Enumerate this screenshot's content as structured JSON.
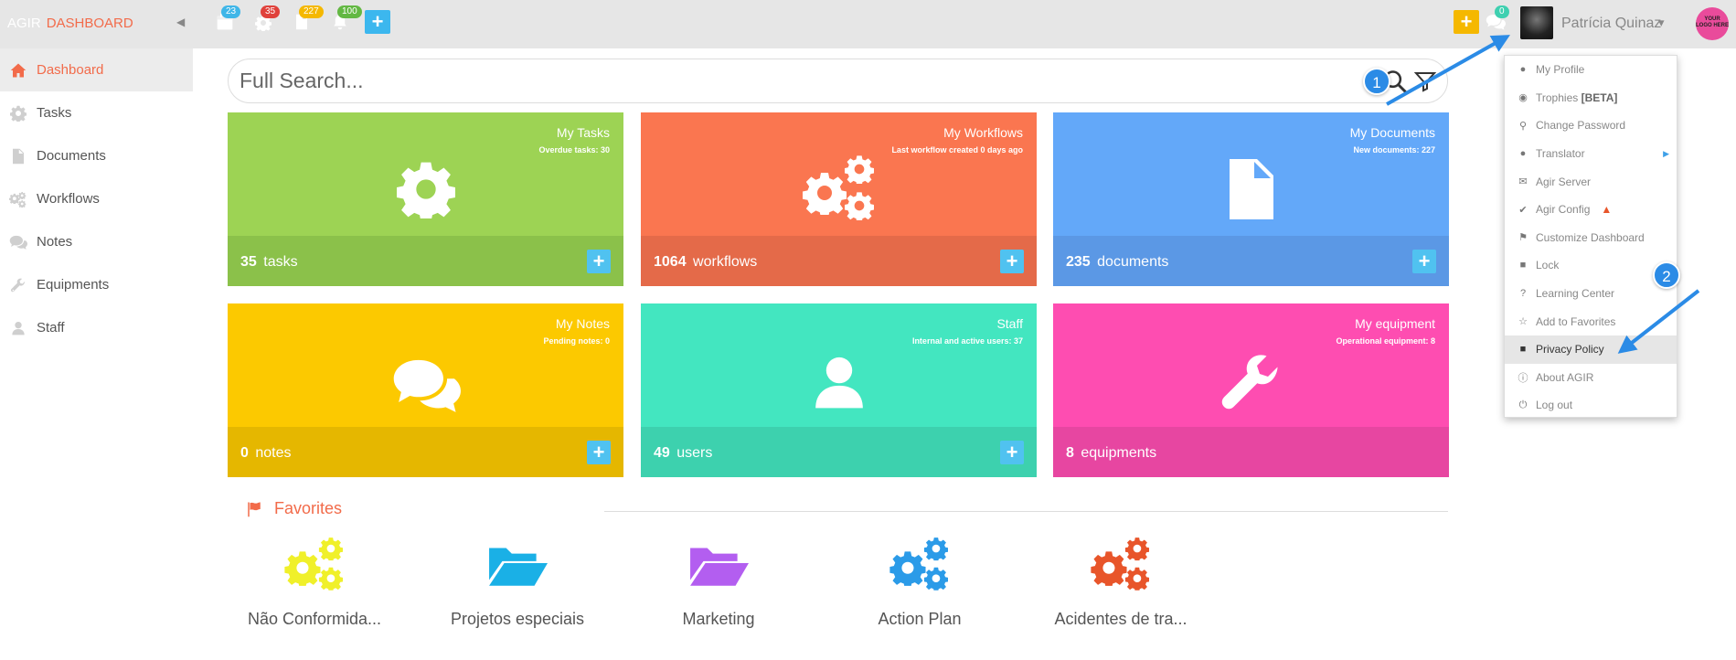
{
  "brand": {
    "app": "AGIR",
    "section": "DASHBOARD"
  },
  "topbar": {
    "badges": [
      {
        "icon": "calendar-icon",
        "count": "23",
        "color": "#3fb6e8"
      },
      {
        "icon": "gear-icon",
        "count": "35",
        "color": "#e0413b"
      },
      {
        "icon": "document-icon",
        "count": "227",
        "color": "#f5b800"
      },
      {
        "icon": "bell-icon",
        "count": "100",
        "color": "#63b843"
      }
    ],
    "add": "+",
    "quick_add": "+",
    "messages_count": "0",
    "user_name": "Patrícia Quinaz",
    "logo_text": "YOUR LOGO HERE"
  },
  "sidebar": {
    "items": [
      {
        "label": "Dashboard",
        "icon": "home-icon",
        "active": true
      },
      {
        "label": "Tasks",
        "icon": "gear-icon"
      },
      {
        "label": "Documents",
        "icon": "document-icon"
      },
      {
        "label": "Workflows",
        "icon": "workflow-icon"
      },
      {
        "label": "Notes",
        "icon": "comments-icon"
      },
      {
        "label": "Equipments",
        "icon": "wrench-icon"
      },
      {
        "label": "Staff",
        "icon": "user-icon"
      }
    ]
  },
  "search": {
    "placeholder": "Full Search..."
  },
  "tiles": [
    {
      "title": "My Tasks",
      "subtitle": "Overdue tasks: 30",
      "count": "35",
      "unit": "tasks",
      "color": "#9dd354",
      "footer": "#8bc14a",
      "icon": "gear-icon",
      "plus": "+"
    },
    {
      "title": "My Workflows",
      "subtitle": "Last workflow created 0 days ago",
      "count": "1064",
      "unit": "workflows",
      "color": "#fa7650",
      "footer": "#e46a49",
      "icon": "gears-icon",
      "plus": "+"
    },
    {
      "title": "My Documents",
      "subtitle": "New documents: 227",
      "count": "235",
      "unit": "documents",
      "color": "#63a8f9",
      "footer": "#5b98e5",
      "icon": "document-icon",
      "plus": "+"
    },
    {
      "title": "My Notes",
      "subtitle": "Pending notes: 0",
      "count": "0",
      "unit": "notes",
      "color": "#fcc900",
      "footer": "#e5b700",
      "icon": "comments-icon",
      "plus": "+"
    },
    {
      "title": "Staff",
      "subtitle": "Internal and active users: 37",
      "count": "49",
      "unit": "users",
      "color": "#43e6c0",
      "footer": "#3dd1ae",
      "icon": "user-icon",
      "plus": "+"
    },
    {
      "title": "My equipment",
      "subtitle": "Operational equipment: 8",
      "count": "8",
      "unit": "equipments",
      "color": "#fe4db1",
      "footer": "#e746a1",
      "icon": "wrench-icon"
    }
  ],
  "favorites": {
    "title": "Favorites",
    "items": [
      {
        "label": "Não Conformida...",
        "icon": "gears-icon",
        "color": "#f0f02a"
      },
      {
        "label": "Projetos especiais",
        "icon": "folder-open-icon",
        "color": "#1ab0e6"
      },
      {
        "label": "Marketing",
        "icon": "folder-open-icon",
        "color": "#b35ef0"
      },
      {
        "label": "Action Plan",
        "icon": "gears-icon",
        "color": "#2b9be8"
      },
      {
        "label": "Acidentes de tra...",
        "icon": "gears-icon",
        "color": "#e8552a"
      }
    ]
  },
  "user_menu": {
    "items": [
      {
        "label": "My Profile",
        "icon": "user-icon"
      },
      {
        "label": "Trophies",
        "badge": "[BETA]",
        "icon": "trophy-icon"
      },
      {
        "label": "Change Password",
        "icon": "key-icon"
      },
      {
        "label": "Translator",
        "icon": "globe-icon",
        "submenu": true
      },
      {
        "label": "Agir Server",
        "icon": "envelope-icon"
      },
      {
        "label": "Agir Config",
        "icon": "wrench-icon",
        "warning": true
      },
      {
        "label": "Customize Dashboard",
        "icon": "flag-icon"
      },
      {
        "label": "Lock",
        "icon": "lock-icon"
      },
      {
        "label": "Learning Center",
        "icon": "question-icon"
      },
      {
        "label": "Add to Favorites",
        "icon": "star-icon"
      },
      {
        "label": "Privacy Policy",
        "icon": "lock-icon",
        "highlight": true
      },
      {
        "label": "About AGIR",
        "icon": "info-icon"
      },
      {
        "label": "Log out",
        "icon": "power-icon"
      }
    ]
  },
  "callouts": {
    "first": "1",
    "second": "2"
  }
}
